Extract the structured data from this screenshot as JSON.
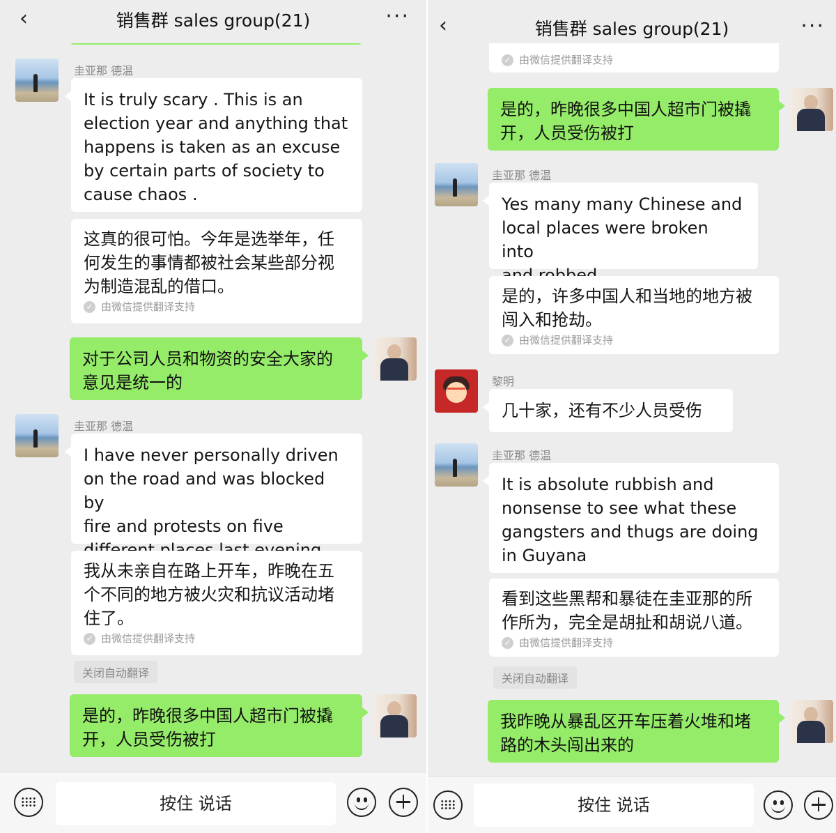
{
  "header": {
    "title": "销售群 sales group(21)",
    "back_icon": "‹",
    "more_icon": "···"
  },
  "footer": {
    "voice_label": "按住 说话"
  },
  "translation_note": "由微信提供翻译支持",
  "close_translate": "关闭自动翻译",
  "left": {
    "m1": {
      "sender": "圭亚那 德温",
      "text": "It is truly scary . This is an\nelection year and anything that\nhappens is taken as an excuse\nby certain parts of society to\ncause chaos .",
      "translation": "这真的很可怕。今年是选举年，任\n何发生的事情都被社会某些部分视\n为制造混乱的借口。"
    },
    "m2": {
      "text": "对于公司人员和物资的安全大家的\n意见是统一的"
    },
    "m3": {
      "sender": "圭亚那 德温",
      "text": "I have never personally driven\non the road and was blocked by\nfire and protests on five\ndifferent places last evening.",
      "translation": "我从未亲自在路上开车，昨晚在五\n个不同的地方被火灾和抗议活动堵\n住了。"
    },
    "m4": {
      "text": "是的，昨晚很多中国人超市门被撬\n开，人员受伤被打"
    }
  },
  "right": {
    "m1": {
      "text": "是的，昨晚很多中国人超市门被撬\n开，人员受伤被打"
    },
    "m2": {
      "sender": "圭亚那 德温",
      "text": "Yes many many Chinese and\nlocal places were broken into\nand robbed",
      "translation": "是的，许多中国人和当地的地方被\n闯入和抢劫。"
    },
    "m3": {
      "sender": "黎明",
      "text": "几十家，还有不少人员受伤"
    },
    "m4": {
      "sender": "圭亚那 德温",
      "text": "It is absolute rubbish and\nnonsense to see what these\ngangsters and thugs are doing\nin Guyana",
      "translation": "看到这些黑帮和暴徒在圭亚那的所\n作所为，完全是胡扯和胡说八道。"
    },
    "m5": {
      "text": "我昨晚从暴乱区开车压着火堆和堵\n路的木头闯出来的"
    }
  }
}
